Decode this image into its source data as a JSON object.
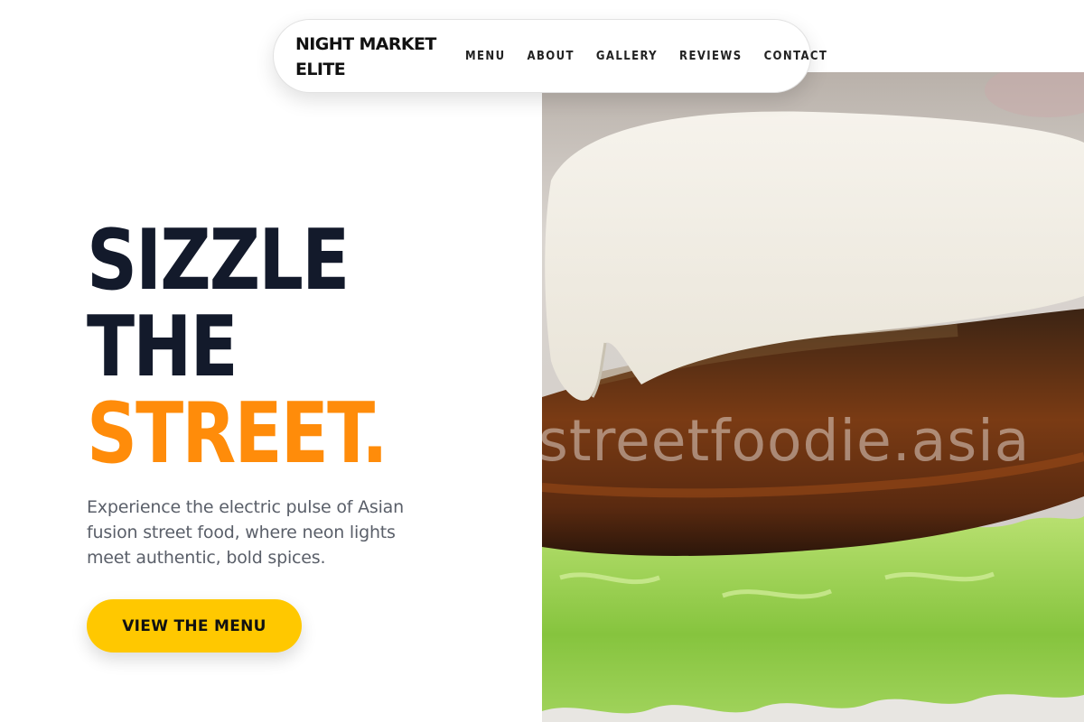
{
  "brand": {
    "name_line1": "NIGHT MARKET",
    "name_line2": "ELITE"
  },
  "nav": {
    "links": [
      {
        "label": "MENU"
      },
      {
        "label": "ABOUT"
      },
      {
        "label": "GALLERY"
      },
      {
        "label": "REVIEWS"
      },
      {
        "label": "CONTACT"
      }
    ]
  },
  "hero": {
    "title_line1": "SIZZLE",
    "title_line2": "THE",
    "title_line3": "STREET.",
    "description": "Experience the electric pulse of Asian fusion street food, where neon lights meet authentic, bold spices.",
    "cta_label": "VIEW THE MENU"
  },
  "hero_image": {
    "subject": "bao-burger-photo-icon",
    "watermark": "streetfoodie.asia"
  },
  "colors": {
    "title_dark": "#131a2b",
    "title_accent": "#ff8c0a",
    "cta_background": "#ffc800",
    "body_text": "#5a5f69"
  }
}
